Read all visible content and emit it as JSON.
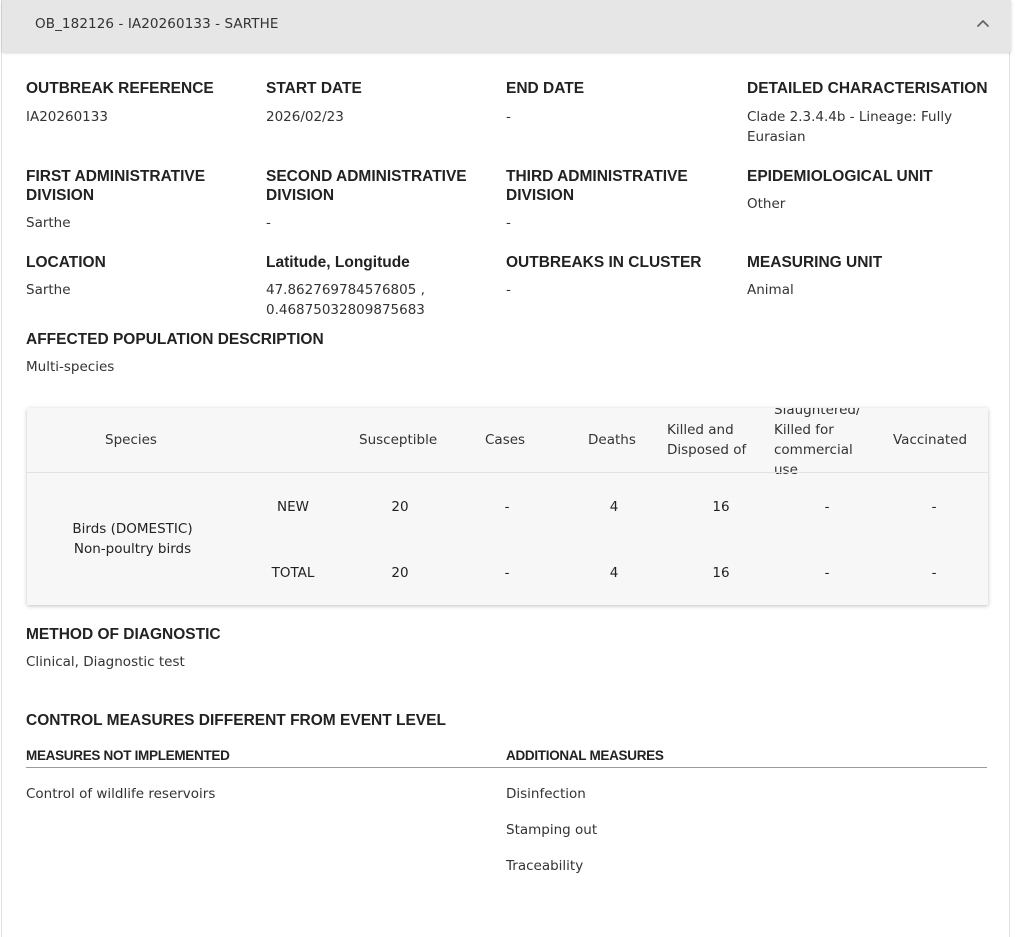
{
  "panel": {
    "title": "OB_182126 - IA20260133 - SARTHE"
  },
  "fields": {
    "outbreak_reference": {
      "label": "OUTBREAK REFERENCE",
      "value": "IA20260133"
    },
    "start_date": {
      "label": "START DATE",
      "value": "2026/02/23"
    },
    "end_date": {
      "label": "END DATE",
      "value": "-"
    },
    "detailed_characterisation": {
      "label": "DETAILED CHARACTERISATION",
      "value_line1": "Clade 2.3.4.4b - Lineage: Fully",
      "value_line2": "Eurasian"
    },
    "first_admin": {
      "label_line1": "FIRST ADMINISTRATIVE",
      "label_line2": "DIVISION",
      "value": "Sarthe"
    },
    "second_admin": {
      "label_line1": "SECOND ADMINISTRATIVE",
      "label_line2": "DIVISION",
      "value": "-"
    },
    "third_admin": {
      "label_line1": "THIRD ADMINISTRATIVE",
      "label_line2": "DIVISION",
      "value": "-"
    },
    "epidemiological_unit": {
      "label": "EPIDEMIOLOGICAL UNIT",
      "value": "Other"
    },
    "location": {
      "label": "LOCATION",
      "value": "Sarthe"
    },
    "lat_long": {
      "label": "Latitude, Longitude",
      "value_line1": "47.862769784576805 ,",
      "value_line2": "0.46875032809875683"
    },
    "outbreaks_in_cluster": {
      "label": "OUTBREAKS IN CLUSTER",
      "value": "-"
    },
    "measuring_unit": {
      "label": "MEASURING UNIT",
      "value": "Animal"
    },
    "affected_population": {
      "label": "AFFECTED POPULATION DESCRIPTION",
      "value": "Multi-species"
    },
    "method_of_diagnostic": {
      "label": "METHOD OF DIAGNOSTIC",
      "value": "Clinical, Diagnostic test"
    }
  },
  "table": {
    "headers": {
      "species": "Species",
      "susceptible": "Susceptible",
      "cases": "Cases",
      "deaths": "Deaths",
      "killed_line1": "Killed and",
      "killed_line2": "Disposed of",
      "slaughtered_line1": "Slaughtered/",
      "slaughtered_line2": "Killed for",
      "slaughtered_line3": "commercial",
      "slaughtered_line4": "use",
      "vaccinated": "Vaccinated"
    },
    "species_line1": "Birds (DOMESTIC)",
    "species_line2": "Non-poultry birds",
    "rows": [
      {
        "type": "NEW",
        "susceptible": "20",
        "cases": "-",
        "deaths": "4",
        "killed": "16",
        "slaughtered": "-",
        "vaccinated": "-"
      },
      {
        "type": "TOTAL",
        "susceptible": "20",
        "cases": "-",
        "deaths": "4",
        "killed": "16",
        "slaughtered": "-",
        "vaccinated": "-"
      }
    ]
  },
  "control_measures": {
    "title": "CONTROL MEASURES DIFFERENT FROM EVENT LEVEL",
    "not_implemented_label": "MEASURES NOT IMPLEMENTED",
    "not_implemented": [
      "Control of wildlife reservoirs"
    ],
    "additional_label": "ADDITIONAL MEASURES",
    "additional": [
      "Disinfection",
      "Stamping out",
      "Traceability"
    ]
  },
  "icons": {
    "collapse": "chevron-up-icon"
  }
}
